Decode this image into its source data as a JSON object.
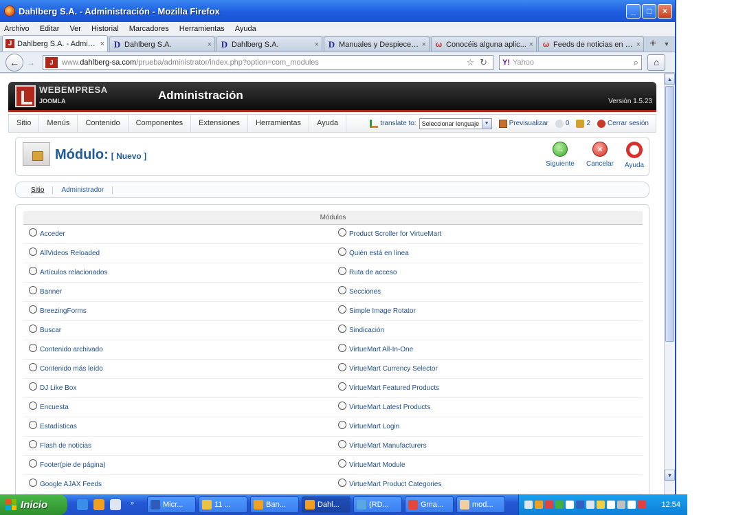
{
  "window": {
    "title": "Dahlberg S.A. - Administración - Mozilla Firefox"
  },
  "menubar": [
    "Archivo",
    "Editar",
    "Ver",
    "Historial",
    "Marcadores",
    "Herramientas",
    "Ayuda"
  ],
  "tabs": [
    {
      "label": "Dahlberg S.A. - Admin...",
      "icon": "joomla"
    },
    {
      "label": "Dahlberg S.A.",
      "icon": "d"
    },
    {
      "label": "Dahlberg S.A.",
      "icon": "d"
    },
    {
      "label": "Manuales y Despieces...",
      "icon": "d"
    },
    {
      "label": "Conocéis alguna aplic...",
      "icon": "w"
    },
    {
      "label": "Feeds de noticias en J...",
      "icon": "w"
    }
  ],
  "tabs_close": "×",
  "navbar": {
    "url_prefix": "www.",
    "url_domain": "dahlberg-sa.com",
    "url_path": "/prueba/administrator/index.php?option=com_modules",
    "search_placeholder": "Yahoo",
    "search_engine": "Y!"
  },
  "joomla": {
    "brand": "WEBEMPRESA",
    "brand_sub": "JOOMLA",
    "title": "Administración",
    "version": "Versión 1.5.23",
    "menu": [
      "Sitio",
      "Menús",
      "Contenido",
      "Componentes",
      "Extensiones",
      "Herramientas",
      "Ayuda"
    ],
    "translate_label": "translate to:",
    "language_select": "Seleccionar lenguaje",
    "preview": "Previsualizar",
    "messages": "0",
    "users": "2",
    "logout": "Cerrar sesión",
    "page_title": "Módulo:",
    "page_subtitle": "[ Nuevo ]",
    "toolbar": {
      "next": "Siguiente",
      "cancel": "Cancelar",
      "help": "Ayuda"
    },
    "submenu": [
      "Sitio",
      "Administrador"
    ],
    "table_header": "Módulos",
    "modules_left": [
      "Acceder",
      "AllVideos Reloaded",
      "Artículos relacionados",
      "Banner",
      "BreezingForms",
      "Buscar",
      "Contenido archivado",
      "Contenido más leído",
      "DJ Like Box",
      "Encuesta",
      "Estadísticas",
      "Flash de noticias",
      "Footer(pie de página)",
      "Google AJAX Feeds"
    ],
    "modules_right": [
      "Product Scroller for VirtueMart",
      "Quién está en línea",
      "Ruta de acceso",
      "Secciones",
      "Simple Image Rotator",
      "Sindicación",
      "VirtueMart All-In-One",
      "VirtueMart Currency Selector",
      "VirtueMart Featured Products",
      "VirtueMart Latest Products",
      "VirtueMart Login",
      "VirtueMart Manufacturers",
      "VirtueMart Module",
      "VirtueMart Product Categories"
    ]
  },
  "taskbar": {
    "start": "Inicio",
    "items": [
      "Micr...",
      "11 ...",
      "Ban...",
      "Dahl...",
      "(RD...",
      "Gma...",
      "mod..."
    ],
    "clock": "12:54"
  },
  "colors": {
    "joomla_red": "#b0281c",
    "link_blue": "#1e5a9c",
    "xp_blue": "#2458d5",
    "start_green": "#2d8f2d"
  }
}
